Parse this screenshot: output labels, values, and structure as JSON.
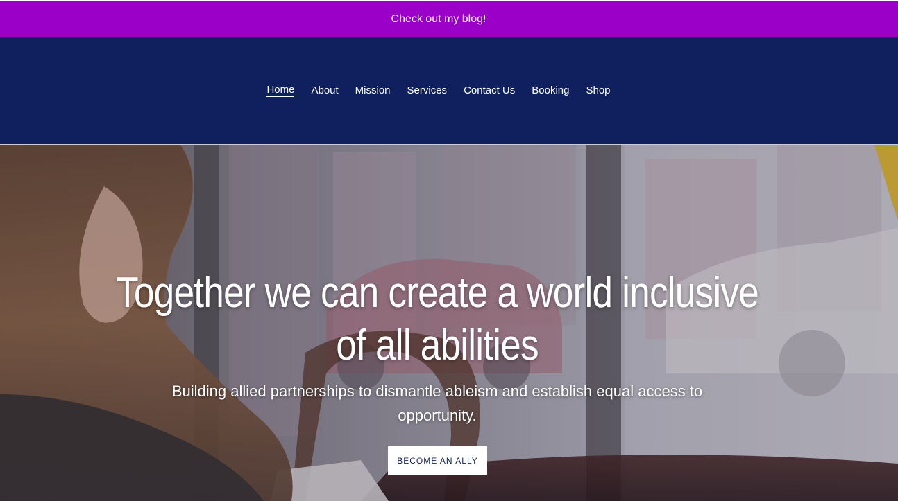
{
  "announcement": {
    "text": "Check out my blog!"
  },
  "nav": {
    "items": [
      {
        "label": "Home",
        "active": true
      },
      {
        "label": "About"
      },
      {
        "label": "Mission"
      },
      {
        "label": "Services"
      },
      {
        "label": "Contact Us"
      },
      {
        "label": "Booking"
      },
      {
        "label": "Shop"
      }
    ]
  },
  "hero": {
    "title": "Together we can create a world inclusive of all abilities",
    "subtitle": "Building allied partnerships to dismantle ableism and establish equal access to opportunity.",
    "button_label": "BECOME AN ALLY"
  },
  "colors": {
    "announcement_bg": "#9a00c7",
    "header_bg": "#10205e",
    "button_text": "#10205e"
  }
}
